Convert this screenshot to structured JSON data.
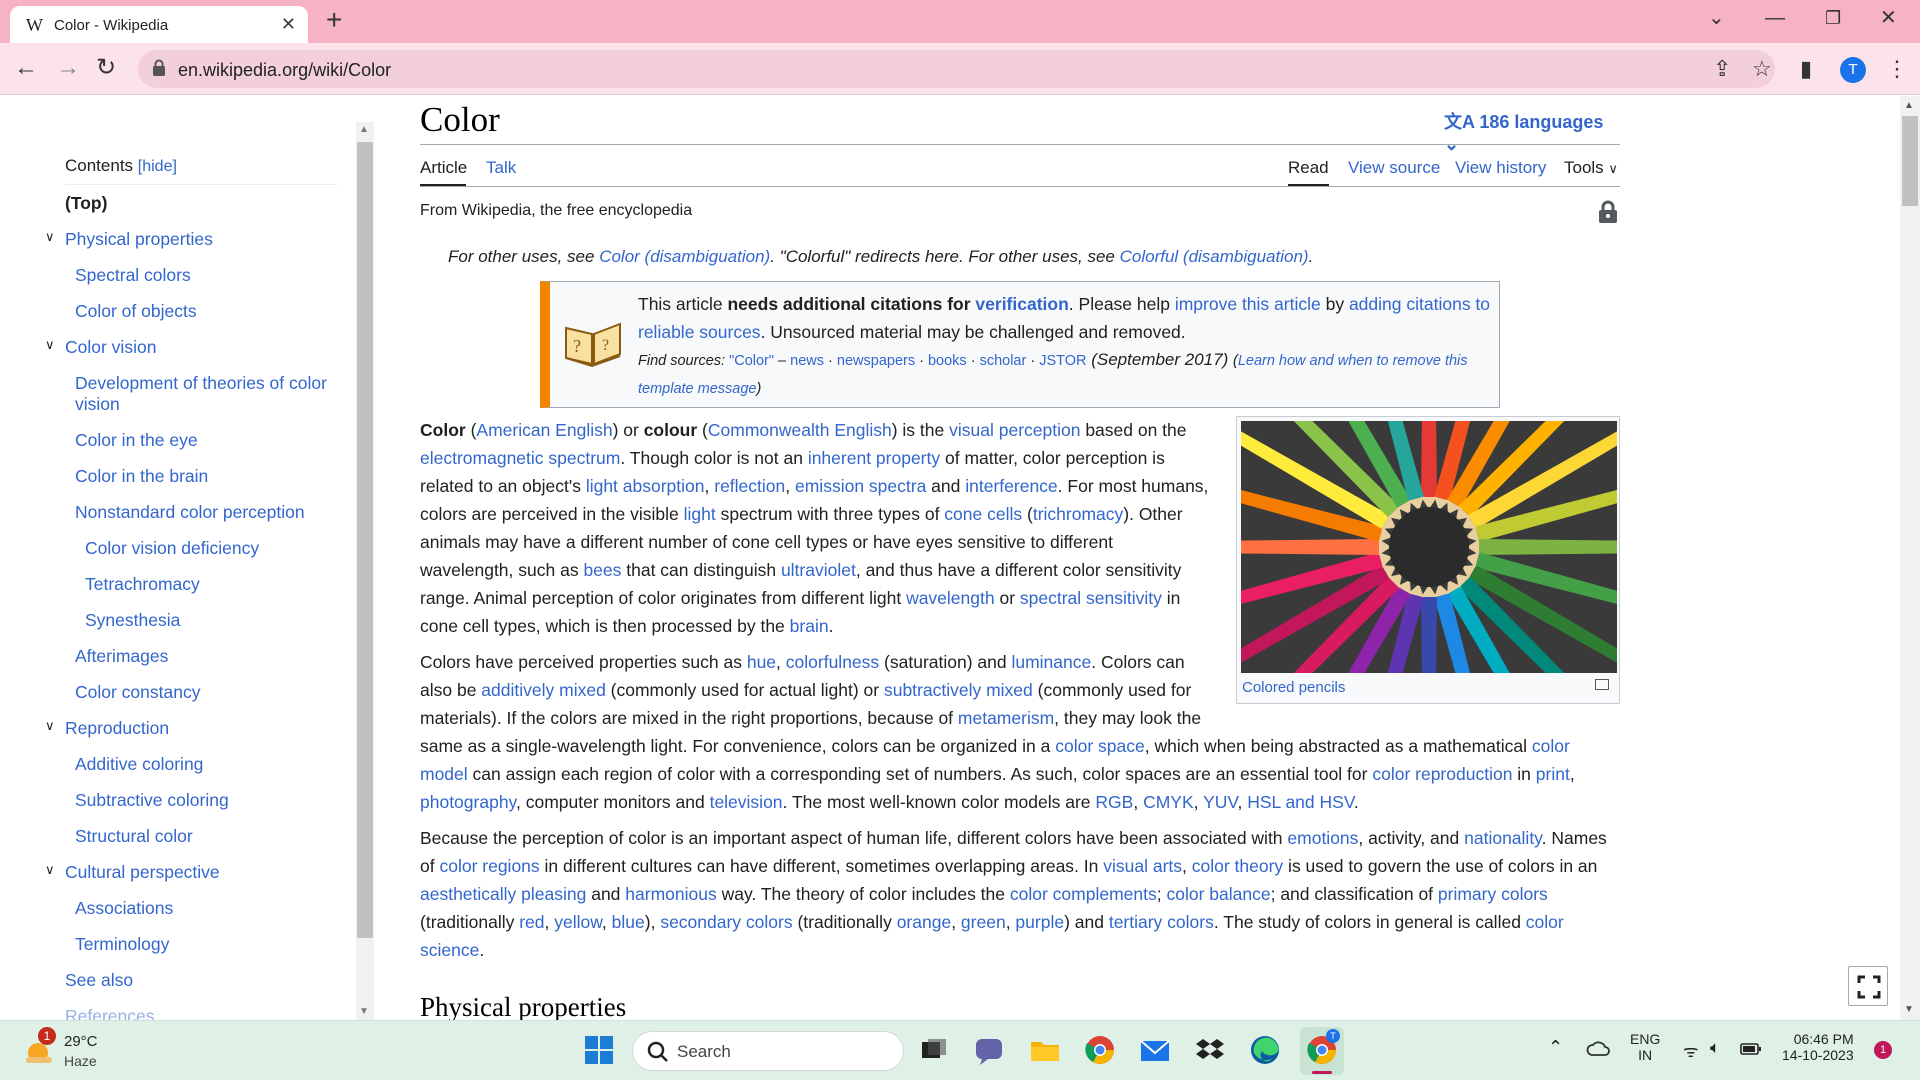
{
  "browser": {
    "tab_title": "Color - Wikipedia",
    "tab_favicon": "W",
    "url": "en.wikipedia.org/wiki/Color",
    "profile_initial": "T"
  },
  "toc": {
    "heading": "Contents",
    "hide_label": "[hide]",
    "items": [
      {
        "label": "(Top)",
        "bold": true
      },
      {
        "label": "Physical properties",
        "expanded": true
      },
      {
        "label": "Spectral colors"
      },
      {
        "label": "Color of objects"
      },
      {
        "label": "Color vision",
        "expanded": true
      },
      {
        "label": "Development of theories of color"
      },
      {
        "label": "vision"
      },
      {
        "label": "Color in the eye"
      },
      {
        "label": "Color in the brain"
      },
      {
        "label": "Nonstandard color perception"
      },
      {
        "label": "Color vision deficiency"
      },
      {
        "label": "Tetrachromacy"
      },
      {
        "label": "Synesthesia"
      },
      {
        "label": "Afterimages"
      },
      {
        "label": "Color constancy"
      },
      {
        "label": "Reproduction",
        "expanded": true
      },
      {
        "label": "Additive coloring"
      },
      {
        "label": "Subtractive coloring"
      },
      {
        "label": "Structural color"
      },
      {
        "label": "Cultural perspective",
        "expanded": true
      },
      {
        "label": "Associations"
      },
      {
        "label": "Terminology"
      },
      {
        "label": "See also"
      },
      {
        "label": "References"
      }
    ]
  },
  "article": {
    "title": "Color",
    "languages": "186 languages",
    "tabs": {
      "article": "Article",
      "talk": "Talk",
      "read": "Read",
      "view_source": "View source",
      "view_history": "View history",
      "tools": "Tools"
    },
    "tagline": "From Wikipedia, the free encyclopedia",
    "hatnote": {
      "a": "For other uses, see ",
      "link1": "Color (disambiguation)",
      "b": ". \"Colorful\" redirects here. For other uses, see ",
      "link2": "Colorful (disambiguation)",
      "c": "."
    },
    "ambox": {
      "t1": "This article ",
      "bold1": "needs additional citations for ",
      "link1": "verification",
      "t2": ". Please help ",
      "link2": "improve this article",
      "t3": " by ",
      "link3": "adding citations to reliable sources",
      "t4": ". Unsourced material may be challenged and removed.",
      "find": "Find sources: ",
      "src_color": "\"Color\"",
      "dash": " – ",
      "src_news": "news",
      "src_newspapers": "newspapers",
      "src_books": "books",
      "src_scholar": "scholar",
      "src_jstor": "JSTOR",
      "date": " (September 2017) ",
      "learn": "Learn how and when to remove this template message"
    },
    "figure_caption": "Colored pencils",
    "section_heading": "Physical properties"
  },
  "taskbar": {
    "temp": "29°C",
    "condition": "Haze",
    "weather_badge": "1",
    "search": "Search",
    "lang1": "ENG",
    "lang2": "IN",
    "time": "06:46 PM",
    "date": "14-10-2023",
    "notif_badge": "1"
  },
  "colors": {
    "link": "#3366cc",
    "tab_strip": "#f6b3c5",
    "toolbar": "#fbe3e9",
    "ambox_border": "#f28500",
    "taskbar": "#dff0e6"
  }
}
